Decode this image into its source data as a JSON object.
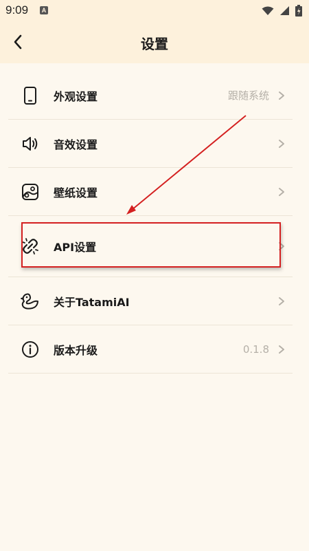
{
  "status_bar": {
    "time": "9:09",
    "notif_glyph": "A"
  },
  "header": {
    "title": "设置"
  },
  "settings": [
    {
      "label": "外观设置",
      "value": "跟随系统",
      "icon": "phone-icon"
    },
    {
      "label": "音效设置",
      "value": "",
      "icon": "speaker-icon"
    },
    {
      "label": "壁纸设置",
      "value": "",
      "icon": "wallpaper-icon"
    },
    {
      "label": "API设置",
      "value": "",
      "icon": "broken-link-icon"
    },
    {
      "label": "关于TatamiAI",
      "value": "",
      "icon": "duck-icon"
    },
    {
      "label": "版本升级",
      "value": "0.1.8",
      "icon": "info-icon"
    }
  ],
  "colors": {
    "background": "#fdf8ef",
    "header": "#fdf1dc",
    "annotation": "#d42020"
  }
}
